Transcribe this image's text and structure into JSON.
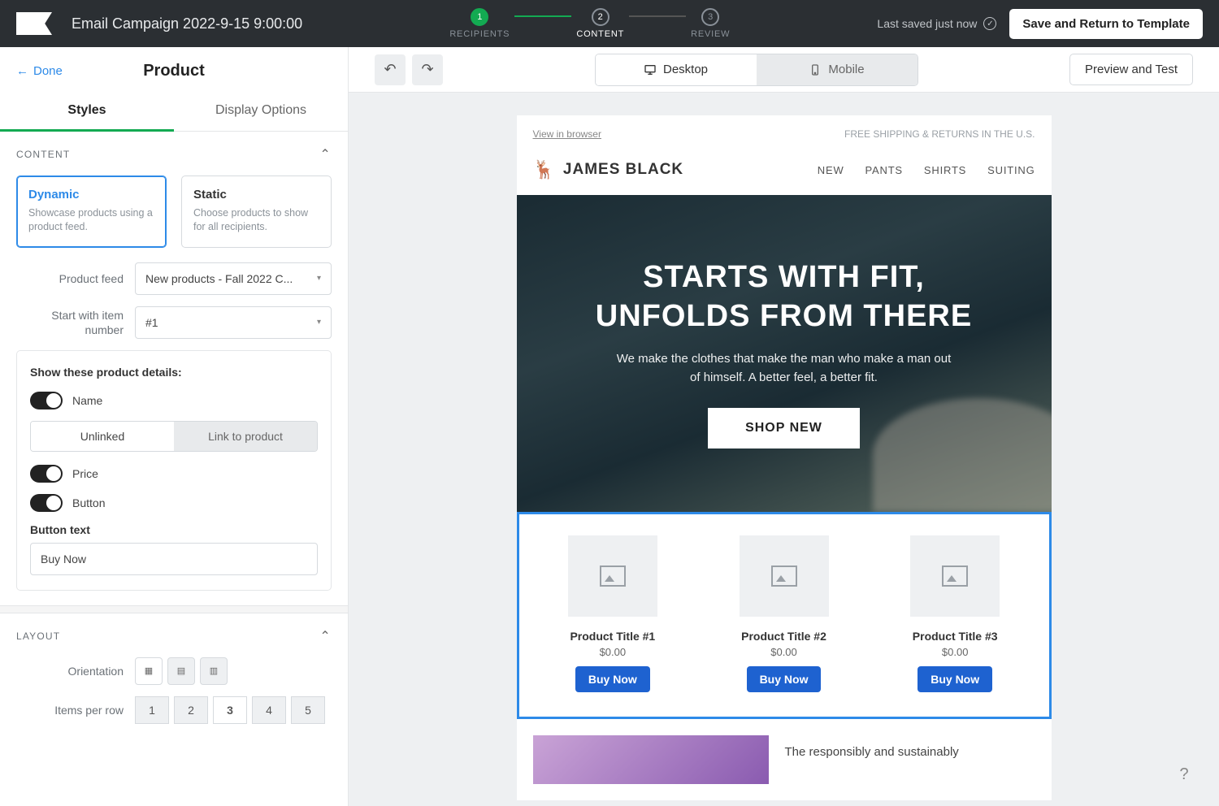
{
  "topbar": {
    "campaign_title": "Email Campaign 2022-9-15 9:00:00",
    "steps": [
      {
        "num": "1",
        "label": "RECIPIENTS"
      },
      {
        "num": "2",
        "label": "CONTENT"
      },
      {
        "num": "3",
        "label": "REVIEW"
      }
    ],
    "last_saved": "Last saved just now",
    "save_return": "Save and Return to Template"
  },
  "sidebar": {
    "done": "Done",
    "title": "Product",
    "tabs": {
      "styles": "Styles",
      "display": "Display Options"
    },
    "content": {
      "heading": "CONTENT",
      "dynamic": {
        "title": "Dynamic",
        "desc": "Showcase products using a product feed."
      },
      "static": {
        "title": "Static",
        "desc": "Choose products to show for all recipients."
      },
      "feed_label": "Product feed",
      "feed_value": "New products - Fall 2022 C...",
      "start_label": "Start with item number",
      "start_value": "#1",
      "details_title": "Show these product details:",
      "name_toggle": "Name",
      "unlinked": "Unlinked",
      "link_to_product": "Link to product",
      "price_toggle": "Price",
      "button_toggle": "Button",
      "button_text_label": "Button text",
      "button_text_value": "Buy Now"
    },
    "layout": {
      "heading": "LAYOUT",
      "orientation_label": "Orientation",
      "items_per_row_label": "Items per row",
      "row_options": [
        "1",
        "2",
        "3",
        "4",
        "5"
      ]
    }
  },
  "toolbar": {
    "desktop": "Desktop",
    "mobile": "Mobile",
    "preview": "Preview and Test"
  },
  "email": {
    "view_in_browser": "View in browser",
    "shipping": "FREE SHIPPING & RETURNS IN THE U.S.",
    "brand": "JAMES BLACK",
    "nav": [
      "NEW",
      "PANTS",
      "SHIRTS",
      "SUITING"
    ],
    "hero_line1": "STARTS WITH FIT,",
    "hero_line2": "UNFOLDS FROM THERE",
    "hero_sub": "We make the clothes that make the man who make a man out of himself. A better feel, a better fit.",
    "hero_cta": "SHOP NEW",
    "products": [
      {
        "title": "Product Title #1",
        "price": "$0.00",
        "btn": "Buy Now"
      },
      {
        "title": "Product Title #2",
        "price": "$0.00",
        "btn": "Buy Now"
      },
      {
        "title": "Product Title #3",
        "price": "$0.00",
        "btn": "Buy Now"
      }
    ],
    "footer_text": "The responsibly and sustainably"
  },
  "help": "?"
}
